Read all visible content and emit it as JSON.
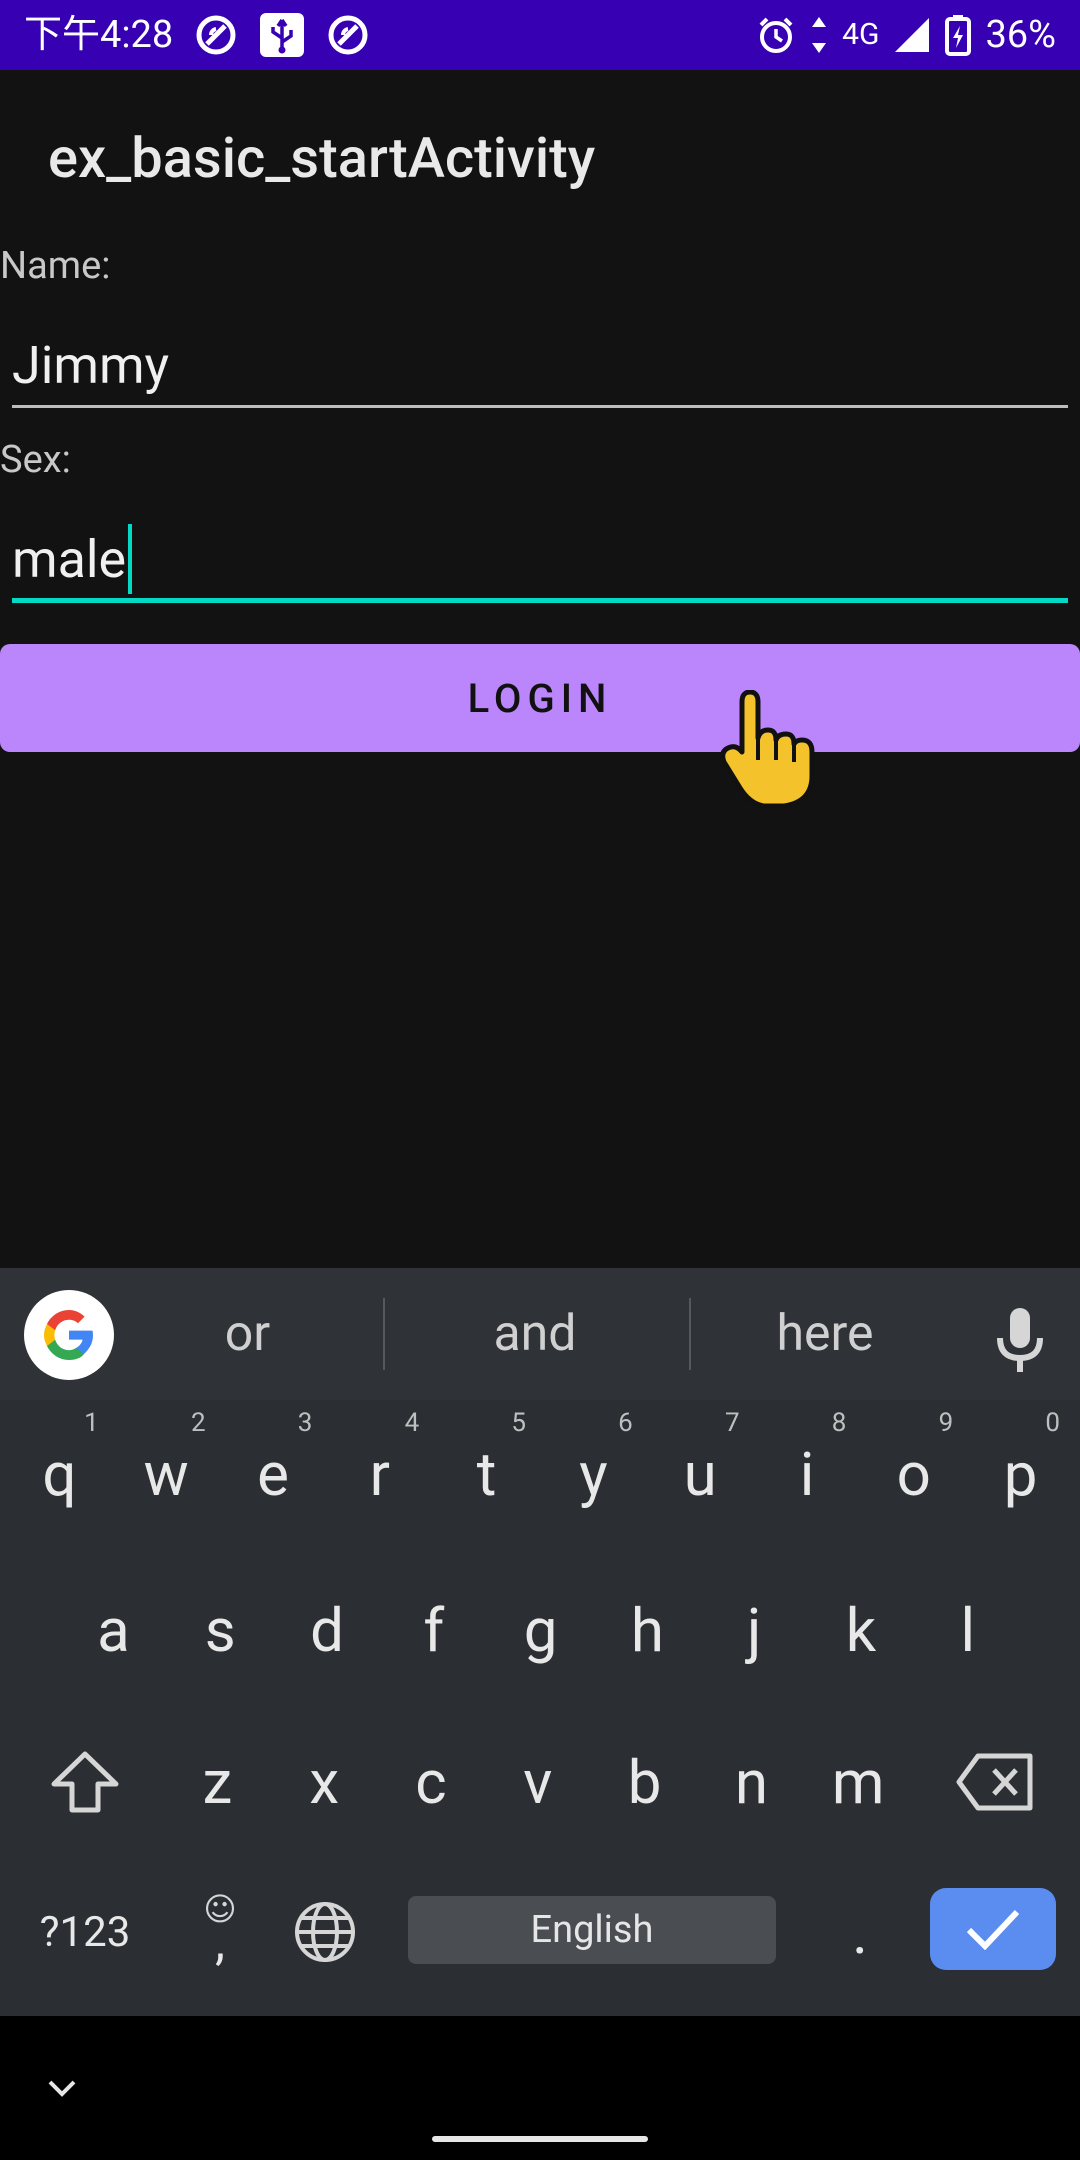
{
  "status_bar": {
    "time": "下午4:28",
    "network": "4G",
    "battery": "36%",
    "icons": [
      "do-not-disturb-icon",
      "usb-icon",
      "do-not-disturb-icon",
      "alarm-icon",
      "data-arrows-icon",
      "signal-icon",
      "battery-charging-icon"
    ]
  },
  "app_bar": {
    "title": "ex_basic_startActivity"
  },
  "form": {
    "name_label": "Name:",
    "name_value": "Jimmy",
    "sex_label": "Sex:",
    "sex_value": "male",
    "login_button": "LOGIN"
  },
  "keyboard": {
    "suggestions": [
      "or",
      "and",
      "here"
    ],
    "rows": [
      [
        {
          "k": "q",
          "n": "1"
        },
        {
          "k": "w",
          "n": "2"
        },
        {
          "k": "e",
          "n": "3"
        },
        {
          "k": "r",
          "n": "4"
        },
        {
          "k": "t",
          "n": "5"
        },
        {
          "k": "y",
          "n": "6"
        },
        {
          "k": "u",
          "n": "7"
        },
        {
          "k": "i",
          "n": "8"
        },
        {
          "k": "o",
          "n": "9"
        },
        {
          "k": "p",
          "n": "0"
        }
      ],
      [
        "a",
        "s",
        "d",
        "f",
        "g",
        "h",
        "j",
        "k",
        "l"
      ],
      [
        "z",
        "x",
        "c",
        "v",
        "b",
        "n",
        "m"
      ]
    ],
    "symbols_key": "?123",
    "comma_key": ",",
    "space_label": "English",
    "period_key": "."
  },
  "colors": {
    "status_bar": "#3700b3",
    "background": "#121212",
    "accent": "#03dac5",
    "button": "#bb86fc",
    "enter_key": "#5b8cf0"
  }
}
